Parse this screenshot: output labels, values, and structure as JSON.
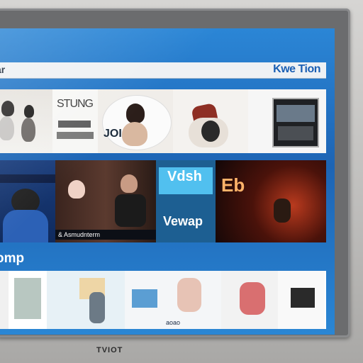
{
  "screen": {
    "top_left_label": "ar",
    "brand_logo_text": "Kwe Tion"
  },
  "row1": {
    "tiles": [
      {
        "name": "row1-tile-1",
        "label": ""
      },
      {
        "name": "row1-tile-2",
        "label": "STUNG"
      },
      {
        "name": "row1-tile-3",
        "label": "JOI"
      },
      {
        "name": "row1-tile-4",
        "label": ""
      },
      {
        "name": "row1-tile-5",
        "label": ""
      }
    ]
  },
  "row2": {
    "tiles": [
      {
        "name": "row2-tile-1",
        "caption": ""
      },
      {
        "name": "row2-tile-2",
        "caption": "& Asmudnterm"
      },
      {
        "name": "row2-tile-3",
        "title": "Vdsh",
        "subtitle": "Vewap"
      },
      {
        "name": "row2-tile-4",
        "caption": "Eb"
      }
    ]
  },
  "section": {
    "title": "omp"
  },
  "row3": {
    "tiles": [
      {
        "name": "row3-tile-1",
        "label": ""
      },
      {
        "name": "row3-tile-2",
        "label": ""
      },
      {
        "name": "row3-tile-3",
        "label": ""
      },
      {
        "name": "row3-tile-4",
        "label": "aoao"
      },
      {
        "name": "row3-tile-5",
        "label": ""
      },
      {
        "name": "row3-tile-6",
        "label": ""
      },
      {
        "name": "row3-tile-7",
        "label": ""
      }
    ]
  },
  "tv": {
    "badge": "TVIOT"
  }
}
